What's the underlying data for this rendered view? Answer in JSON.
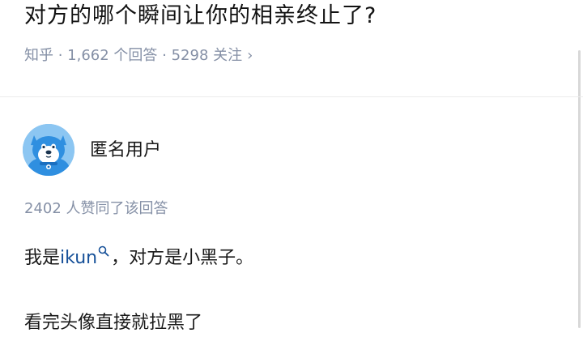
{
  "question": {
    "title": "对方的哪个瞬间让你的相亲终止了?",
    "meta": "知乎 · 1,662 个回答 · 5298 关注",
    "chevron": "›"
  },
  "answer": {
    "author": "匿名用户",
    "upvote_text": "2402 人赞同了该回答",
    "line1_prefix": "我是",
    "line1_keyword": "ikun",
    "line1_suffix": "，对方是小黑子。",
    "line2": "看完头像直接就拉黑了"
  },
  "colors": {
    "link": "#175199",
    "meta": "#8590a6",
    "text": "#1a1a1a"
  }
}
